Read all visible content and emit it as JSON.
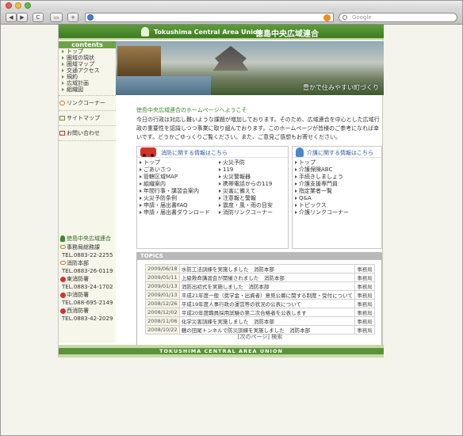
{
  "browser": {
    "search_placeholder": "Google",
    "nav_back": "◀",
    "nav_forward": "▶",
    "reload": "C",
    "add": "+"
  },
  "header": {
    "title_en": "Tokushima Central Area Union",
    "title_jp": "徳島中央広域連合"
  },
  "banner": {
    "slogan": "豊かで住みやすい町づくり"
  },
  "sidebar": {
    "heading": "contents",
    "items": [
      "トップ",
      "圏域の現状",
      "圏域マップ",
      "交通アクセス",
      "規約",
      "広域計画",
      "組織図"
    ],
    "links": [
      "リンクコーナー",
      "サイトマップ",
      "お問い合わせ"
    ],
    "org_title": "徳島中央広域連合",
    "orgs": [
      {
        "name": "事務局総務課",
        "tel": "TEL.0883-22-2255"
      },
      {
        "name": "消防本部",
        "tel": "TEL.0883-26-0119"
      },
      {
        "name": "東消防署",
        "tel": "TEL.0883-24-1702"
      },
      {
        "name": "中消防署",
        "tel": "TEL.088-695-2149"
      },
      {
        "name": "西消防署",
        "tel": "TEL.0883-42-2029"
      }
    ]
  },
  "main": {
    "welcome": "徳島中央広域連合のホームページへようこそ",
    "intro": "今日の行政は対応し難いような課題が増加しております。そのため、広域連合を中心とした広域行政の重要性を認識しつつ事業に取り組んでおります。このホームページが皆様のご参考になれば幸いです。どうかごゆっくりご覧ください。また、ご意見ご感想もお寄せください。"
  },
  "fire_box": {
    "title": "消防に関する情報はこちら",
    "col1": [
      "トップ",
      "ごあいさつ",
      "管轄区域MAP",
      "組織案内",
      "年間行事・講習会案内",
      "火災予防条例",
      "申請・届出書FAQ",
      "申請・届出書ダウンロード"
    ],
    "col2": [
      "火災予防",
      "119",
      "火災警報器",
      "携帯電話からの119",
      "災害に備えて",
      "注意報と警報",
      "震度・風・雨の目安",
      "消防リンクコーナー"
    ]
  },
  "care_box": {
    "title": "介護に関する情報はこちら",
    "items": [
      "トップ",
      "介護保険ABC",
      "手続きしましょう",
      "介護支援専門員",
      "指定業者一覧",
      "Q&A",
      "トピックス",
      "介護リンクコーナー"
    ]
  },
  "topics": {
    "heading": "TOPICS",
    "rows": [
      {
        "date": "2009/06/18",
        "title": "水防工法訓練を実施しました　消防本部",
        "dept": "事務局"
      },
      {
        "date": "2009/05/11",
        "title": "上級救命講習会が開催されました　消防本部",
        "dept": "事務局"
      },
      {
        "date": "2009/01/13",
        "title": "消防出初式を実施しました　消防本部",
        "dept": "事務局"
      },
      {
        "date": "2009/01/13",
        "title": "平成21年度一般（奨学金・出資者）意見公募に関する制度・受付について",
        "dept": "事務局"
      },
      {
        "date": "2008/12/26",
        "title": "平成19年度人事行政の運営等の状況の公表について",
        "dept": "事務局"
      },
      {
        "date": "2008/12/02",
        "title": "平成20年度職員採用試験の第二次合格者を公表します",
        "dept": "事務局"
      },
      {
        "date": "2008/11/06",
        "title": "化学災害訓練を実施しました　消防本部",
        "dept": "事務局"
      },
      {
        "date": "2008/10/22",
        "title": "鶴の田尾トンネルで防災訓練を実施しました　消防本部",
        "dept": "事務局"
      }
    ],
    "pager": "[次のページ] 検索"
  },
  "footer": {
    "text": "TOKUSHIMA CENTRAL AREA UNION"
  }
}
